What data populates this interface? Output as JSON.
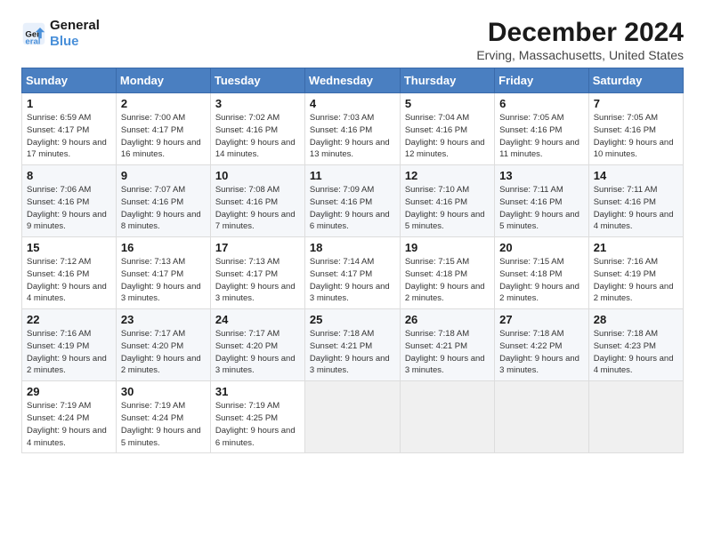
{
  "logo": {
    "line1": "General",
    "line2": "Blue"
  },
  "title": "December 2024",
  "subtitle": "Erving, Massachusetts, United States",
  "days_of_week": [
    "Sunday",
    "Monday",
    "Tuesday",
    "Wednesday",
    "Thursday",
    "Friday",
    "Saturday"
  ],
  "weeks": [
    [
      {
        "day": "1",
        "info": "Sunrise: 6:59 AM\nSunset: 4:17 PM\nDaylight: 9 hours and 17 minutes."
      },
      {
        "day": "2",
        "info": "Sunrise: 7:00 AM\nSunset: 4:17 PM\nDaylight: 9 hours and 16 minutes."
      },
      {
        "day": "3",
        "info": "Sunrise: 7:02 AM\nSunset: 4:16 PM\nDaylight: 9 hours and 14 minutes."
      },
      {
        "day": "4",
        "info": "Sunrise: 7:03 AM\nSunset: 4:16 PM\nDaylight: 9 hours and 13 minutes."
      },
      {
        "day": "5",
        "info": "Sunrise: 7:04 AM\nSunset: 4:16 PM\nDaylight: 9 hours and 12 minutes."
      },
      {
        "day": "6",
        "info": "Sunrise: 7:05 AM\nSunset: 4:16 PM\nDaylight: 9 hours and 11 minutes."
      },
      {
        "day": "7",
        "info": "Sunrise: 7:05 AM\nSunset: 4:16 PM\nDaylight: 9 hours and 10 minutes."
      }
    ],
    [
      {
        "day": "8",
        "info": "Sunrise: 7:06 AM\nSunset: 4:16 PM\nDaylight: 9 hours and 9 minutes."
      },
      {
        "day": "9",
        "info": "Sunrise: 7:07 AM\nSunset: 4:16 PM\nDaylight: 9 hours and 8 minutes."
      },
      {
        "day": "10",
        "info": "Sunrise: 7:08 AM\nSunset: 4:16 PM\nDaylight: 9 hours and 7 minutes."
      },
      {
        "day": "11",
        "info": "Sunrise: 7:09 AM\nSunset: 4:16 PM\nDaylight: 9 hours and 6 minutes."
      },
      {
        "day": "12",
        "info": "Sunrise: 7:10 AM\nSunset: 4:16 PM\nDaylight: 9 hours and 5 minutes."
      },
      {
        "day": "13",
        "info": "Sunrise: 7:11 AM\nSunset: 4:16 PM\nDaylight: 9 hours and 5 minutes."
      },
      {
        "day": "14",
        "info": "Sunrise: 7:11 AM\nSunset: 4:16 PM\nDaylight: 9 hours and 4 minutes."
      }
    ],
    [
      {
        "day": "15",
        "info": "Sunrise: 7:12 AM\nSunset: 4:16 PM\nDaylight: 9 hours and 4 minutes."
      },
      {
        "day": "16",
        "info": "Sunrise: 7:13 AM\nSunset: 4:17 PM\nDaylight: 9 hours and 3 minutes."
      },
      {
        "day": "17",
        "info": "Sunrise: 7:13 AM\nSunset: 4:17 PM\nDaylight: 9 hours and 3 minutes."
      },
      {
        "day": "18",
        "info": "Sunrise: 7:14 AM\nSunset: 4:17 PM\nDaylight: 9 hours and 3 minutes."
      },
      {
        "day": "19",
        "info": "Sunrise: 7:15 AM\nSunset: 4:18 PM\nDaylight: 9 hours and 2 minutes."
      },
      {
        "day": "20",
        "info": "Sunrise: 7:15 AM\nSunset: 4:18 PM\nDaylight: 9 hours and 2 minutes."
      },
      {
        "day": "21",
        "info": "Sunrise: 7:16 AM\nSunset: 4:19 PM\nDaylight: 9 hours and 2 minutes."
      }
    ],
    [
      {
        "day": "22",
        "info": "Sunrise: 7:16 AM\nSunset: 4:19 PM\nDaylight: 9 hours and 2 minutes."
      },
      {
        "day": "23",
        "info": "Sunrise: 7:17 AM\nSunset: 4:20 PM\nDaylight: 9 hours and 2 minutes."
      },
      {
        "day": "24",
        "info": "Sunrise: 7:17 AM\nSunset: 4:20 PM\nDaylight: 9 hours and 3 minutes."
      },
      {
        "day": "25",
        "info": "Sunrise: 7:18 AM\nSunset: 4:21 PM\nDaylight: 9 hours and 3 minutes."
      },
      {
        "day": "26",
        "info": "Sunrise: 7:18 AM\nSunset: 4:21 PM\nDaylight: 9 hours and 3 minutes."
      },
      {
        "day": "27",
        "info": "Sunrise: 7:18 AM\nSunset: 4:22 PM\nDaylight: 9 hours and 3 minutes."
      },
      {
        "day": "28",
        "info": "Sunrise: 7:18 AM\nSunset: 4:23 PM\nDaylight: 9 hours and 4 minutes."
      }
    ],
    [
      {
        "day": "29",
        "info": "Sunrise: 7:19 AM\nSunset: 4:24 PM\nDaylight: 9 hours and 4 minutes."
      },
      {
        "day": "30",
        "info": "Sunrise: 7:19 AM\nSunset: 4:24 PM\nDaylight: 9 hours and 5 minutes."
      },
      {
        "day": "31",
        "info": "Sunrise: 7:19 AM\nSunset: 4:25 PM\nDaylight: 9 hours and 6 minutes."
      },
      null,
      null,
      null,
      null
    ]
  ]
}
